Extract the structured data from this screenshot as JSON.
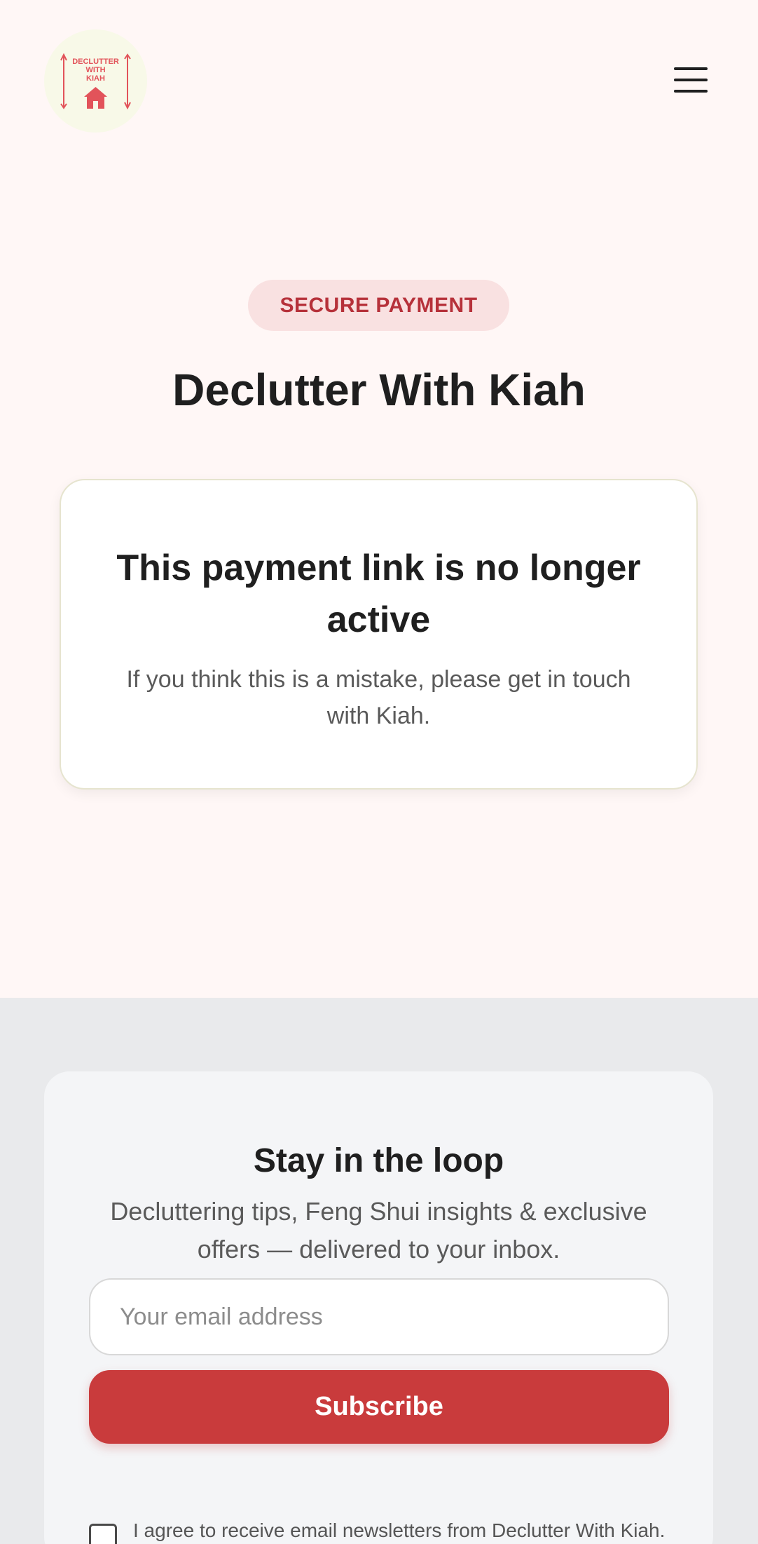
{
  "header": {
    "logo": {
      "line1": "DECLUTTER",
      "line2": "WITH",
      "line3": "KIAH",
      "icon": "house-icon",
      "color": "#e2535a"
    },
    "menu_icon": "hamburger-menu-icon"
  },
  "main": {
    "badge": "SECURE PAYMENT",
    "merchant_name": "Declutter With Kiah",
    "card": {
      "title": "This payment link is no longer active",
      "message": "If you think this is a mistake, please get in touch with Kiah."
    }
  },
  "newsletter": {
    "title": "Stay in the loop",
    "description": "Decluttering tips, Feng Shui insights & exclusive offers — delivered to your inbox.",
    "email_placeholder": "Your email address",
    "subscribe_label": "Subscribe",
    "consent_text": "I agree to receive email newsletters from Declutter With Kiah. You can unsubscribe at any time.",
    "consent_checked": false
  },
  "colors": {
    "accent": "#c93b3c",
    "badge_bg": "#f9e1e1",
    "badge_text": "#b6313a",
    "page_bg": "#fff7f6",
    "footer_bg": "#e9eaec"
  }
}
